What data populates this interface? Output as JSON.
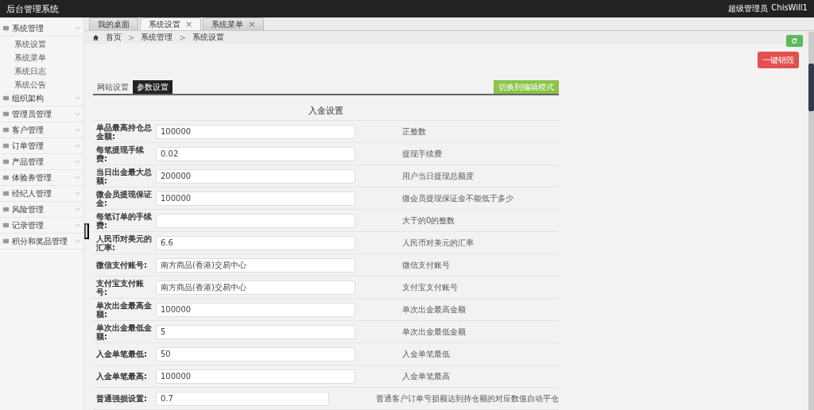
{
  "header": {
    "title": "后台管理系统",
    "user_role": "超级管理员",
    "user_name": "ChisWill1"
  },
  "sidebar": {
    "items": [
      {
        "label": "系统管理",
        "expanded": true,
        "children": [
          {
            "label": "系统设置"
          },
          {
            "label": "系统菜单"
          },
          {
            "label": "系统日志"
          },
          {
            "label": "系统公告"
          }
        ]
      },
      {
        "label": "组织架构",
        "expanded": false
      },
      {
        "label": "管理员管理",
        "expanded": false
      },
      {
        "label": "客户管理",
        "expanded": false
      },
      {
        "label": "订单管理",
        "expanded": false
      },
      {
        "label": "产品管理",
        "expanded": false
      },
      {
        "label": "体验券管理",
        "expanded": false
      },
      {
        "label": "经纪人管理",
        "expanded": false
      },
      {
        "label": "风险管理",
        "expanded": false
      },
      {
        "label": "记录管理",
        "expanded": false
      },
      {
        "label": "积分和奖品管理",
        "expanded": false
      }
    ]
  },
  "page_tabs": [
    {
      "label": "我的桌面",
      "selected": false
    },
    {
      "label": "系统设置",
      "selected": true,
      "close_icon": "×"
    },
    {
      "label": "系统菜单",
      "selected": false,
      "close_icon": "×"
    }
  ],
  "breadcrumb": {
    "items": [
      "首页",
      "系统管理",
      "系统设置"
    ],
    "separators": [
      ">",
      ">"
    ]
  },
  "destroy_button": "一键销毁",
  "settings_tabs": [
    {
      "label": "网站设置",
      "selected": false
    },
    {
      "label": "参数设置",
      "selected": true
    }
  ],
  "edit_mode_button": "切换到编辑模式",
  "section_title": "入金设置",
  "fields": [
    {
      "label": "单品最高持仓总金额:",
      "value": "100000",
      "hint": "正整数"
    },
    {
      "label": "每笔提现手续费:",
      "value": "0.02",
      "hint": "提现手续费"
    },
    {
      "label": "当日出金最大总额:",
      "value": "200000",
      "hint": "用户当日提现总额度"
    },
    {
      "label": "微会员提现保证金:",
      "value": "100000",
      "hint": "微会员提现保证金不能低于多少"
    },
    {
      "label": "每笔订单的手续费:",
      "hint": "大于的0的整数"
    },
    {
      "label": "人民币对美元的汇率:",
      "value": "6.6",
      "hint": "人民币对美元的汇率"
    },
    {
      "label": "微信支付账号:",
      "value": "南方商品(香港)交易中心",
      "hint": "微信支付账号"
    },
    {
      "label": "支付宝支付账号:",
      "value": "南方商品(香港)交易中心",
      "hint": "支付宝支付账号"
    },
    {
      "label": "单次出金最高金额:",
      "value": "100000",
      "hint": "单次出金最高金额"
    },
    {
      "label": "单次出金最低金额:",
      "value": "5",
      "hint": "单次出金最低金额"
    },
    {
      "label": "入金单笔最低:",
      "value": "50",
      "hint": "入金单笔最低"
    },
    {
      "label": "入金单笔最高:",
      "value": "100000",
      "hint": "入金单笔最高"
    },
    {
      "label": "普通强损设置:",
      "value": "0.7",
      "hint": "普通客户订单亏损额达到持仓额的对应数值自动平仓"
    }
  ]
}
